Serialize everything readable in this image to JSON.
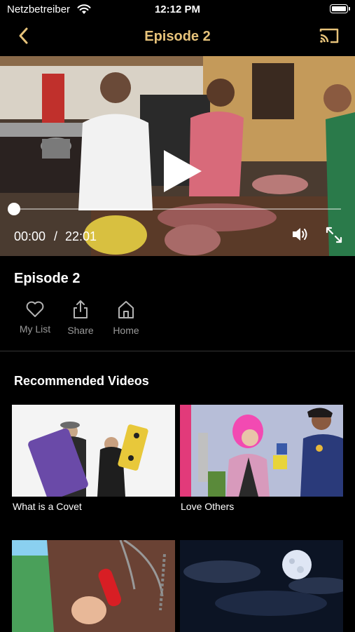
{
  "status_bar": {
    "carrier": "Netzbetreiber",
    "time": "12:12 PM"
  },
  "nav": {
    "title": "Episode 2"
  },
  "player": {
    "current_time": "00:00",
    "separator": "/",
    "total_time": "22:01",
    "progress": 0
  },
  "episode": {
    "title": "Episode 2"
  },
  "actions": [
    {
      "label": "My List",
      "icon": "heart-icon"
    },
    {
      "label": "Share",
      "icon": "share-icon"
    },
    {
      "label": "Home",
      "icon": "home-icon"
    }
  ],
  "recommended": {
    "title": "Recommended Videos",
    "items": [
      {
        "title": "What is a Covet"
      },
      {
        "title": "Love Others"
      },
      {
        "title": ""
      },
      {
        "title": ""
      }
    ]
  },
  "colors": {
    "accent": "#e6c27a",
    "background": "#000000",
    "secondary_text": "#9a9a9a"
  }
}
